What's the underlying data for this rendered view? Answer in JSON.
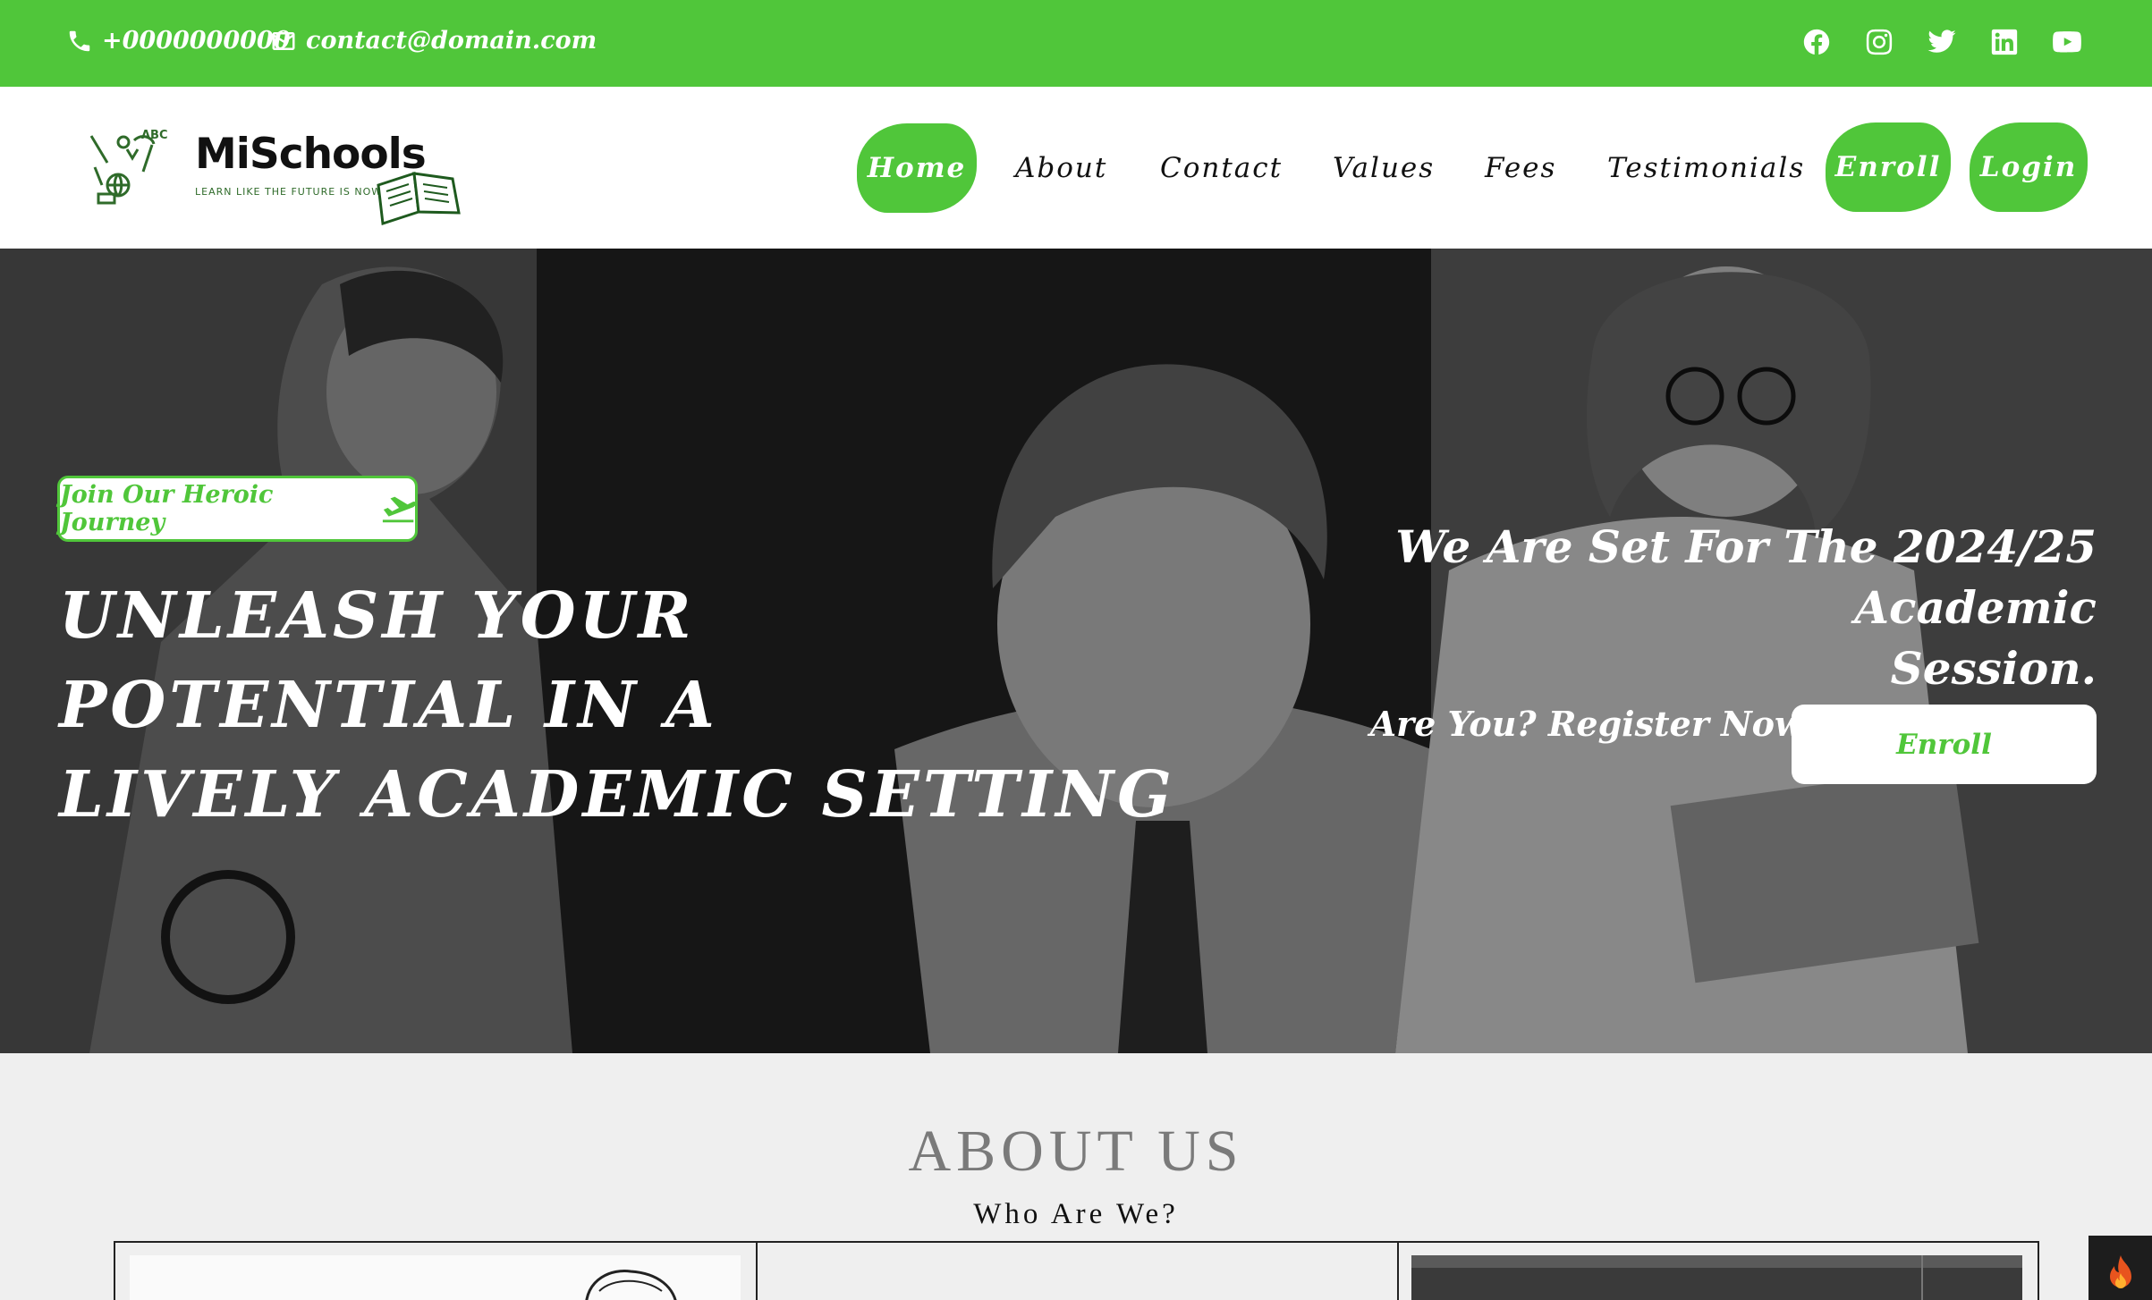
{
  "topbar": {
    "phone": "+0000000000",
    "email": "contact@domain.com",
    "socials": [
      "facebook-icon",
      "instagram-icon",
      "twitter-icon",
      "linkedin-icon",
      "youtube-icon"
    ]
  },
  "logo": {
    "title": "MiSchools",
    "tagline": "LEARN LIKE THE FUTURE IS NOW"
  },
  "nav": {
    "home": "Home",
    "about": "About",
    "contact": "Contact",
    "values": "Values",
    "fees": "Fees",
    "testimonials": "Testimonials",
    "enroll": "Enroll",
    "login": "Login"
  },
  "hero": {
    "badge": "Join Our Heroic Journey",
    "headline": [
      "UNLEASH YOUR",
      "POTENTIAL IN A",
      "LIVELY ACADEMIC SETTING"
    ],
    "announce_line1": "We Are Set For The 2024/25 Academic",
    "announce_line2": "Session.",
    "announce_sub": "Are You? Register Now With Us Today.",
    "enroll": "Enroll"
  },
  "about": {
    "title": "ABOUT US",
    "subtitle": "Who Are We?"
  },
  "colors": {
    "accent": "#50c63a",
    "white": "#ffffff",
    "dark": "#111111"
  }
}
